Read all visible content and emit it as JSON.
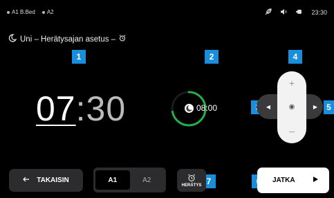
{
  "status": {
    "bed_a1": "A1 B.Bed",
    "bed_a2": "A2",
    "time": "23:30",
    "icons": [
      "feather-icon",
      "speaker-icon",
      "battery-icon"
    ]
  },
  "title": {
    "icon": "sleep-moon-icon",
    "text": "Uni – Herätysajan asetus –",
    "trailing_icon": "alarm-clock-icon"
  },
  "badges": [
    "1",
    "2",
    "3",
    "4",
    "5",
    "6",
    "7"
  ],
  "alarm": {
    "hours": "07",
    "separator": ":",
    "minutes": "30"
  },
  "duration": {
    "icon": "sleep-half-moon-icon",
    "value": "08:00",
    "progress": 0.72
  },
  "dpad": {
    "up": "+",
    "down": "–",
    "left": "◀",
    "right": "▶",
    "center": "◉"
  },
  "footer": {
    "back_icon": "arrow-left-icon",
    "back_label": "TAKAISIN",
    "segments": [
      {
        "label": "A1",
        "active": true
      },
      {
        "label": "A2",
        "active": false
      }
    ],
    "wake_icon": "alarm-clock-icon",
    "wake_label": "HERÄTYS",
    "next_label": "JATKA",
    "next_icon": "play-triangle-icon"
  },
  "colors": {
    "accent": "#1a8ddb",
    "ring": "#22b04b",
    "background": "#000000"
  }
}
